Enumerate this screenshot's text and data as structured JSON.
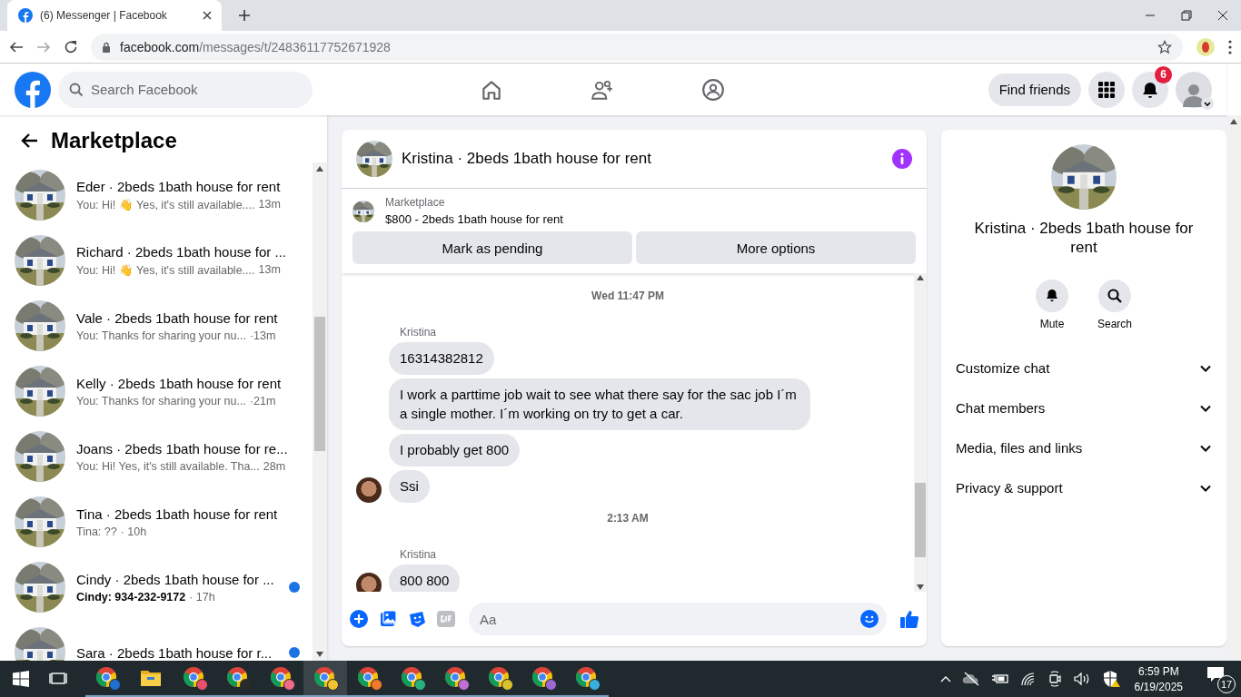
{
  "browser": {
    "tab": {
      "title": "(6) Messenger | Facebook"
    },
    "url": {
      "domain": "facebook.com",
      "path": "/messages/t/24836117752671928"
    }
  },
  "topbar": {
    "search": {
      "placeholder": "Search Facebook"
    },
    "nav": [
      {
        "kind": "home"
      },
      {
        "kind": "friends"
      },
      {
        "kind": "groups"
      }
    ],
    "find_friends": "Find friends",
    "notifications_badge": "6"
  },
  "sidebar": {
    "title": "Marketplace",
    "conversations": [
      {
        "title": "Eder · 2beds 1bath house for rent",
        "preview": "You: Hi! 👋 Yes, it's still available....",
        "time": "13m",
        "unread": false
      },
      {
        "title": "Richard · 2beds 1bath house for ...",
        "preview": "You: Hi! 👋 Yes, it's still available....",
        "time": "13m",
        "unread": false
      },
      {
        "title": "Vale · 2beds 1bath house for rent",
        "preview": "You: Thanks for sharing your nu...",
        "time": "·13m",
        "unread": false
      },
      {
        "title": "Kelly · 2beds 1bath house for rent",
        "preview": "You: Thanks for sharing your nu...",
        "time": "·21m",
        "unread": false
      },
      {
        "title": "Joans · 2beds 1bath house for re...",
        "preview": "You: Hi! Yes, it's still available. Tha...",
        "time": "28m",
        "unread": false
      },
      {
        "title": "Tina · 2beds 1bath house for rent",
        "preview": "Tina: ??",
        "time": "· 10h",
        "unread": false
      },
      {
        "title": "Cindy · 2beds 1bath house for ...",
        "preview": "Cindy: 934-232-9172",
        "time": "· 17h",
        "unread": true
      },
      {
        "title": "Sara · 2beds 1bath house for r...",
        "unread": true
      }
    ]
  },
  "chat": {
    "title": "Kristina · 2beds 1bath house for rent",
    "listing": {
      "source": "Marketplace",
      "name": "$800 - 2beds 1bath house for rent"
    },
    "actions": [
      "Mark as pending",
      "More options"
    ],
    "messages": [
      {
        "kind": "timestamp",
        "text": "Wed 11:47 PM"
      },
      {
        "kind": "sender",
        "text": "Kristina"
      },
      {
        "kind": "message",
        "text": "16314382812",
        "avatar": false
      },
      {
        "kind": "message",
        "text": "I work a parttime job  wait to see what there say for the sac job I´m a single mother. I´m working on try to get a car.",
        "avatar": false
      },
      {
        "kind": "message",
        "text": "I probably get 800",
        "avatar": false
      },
      {
        "kind": "message",
        "text": "Ssi",
        "avatar": true
      },
      {
        "kind": "timestamp",
        "text": "2:13 AM"
      },
      {
        "kind": "sender",
        "text": "Kristina"
      },
      {
        "kind": "message",
        "text": "800 800",
        "avatar": true
      }
    ],
    "composer": {
      "placeholder": "Aa"
    }
  },
  "details": {
    "title": "Kristina · 2beds 1bath house for rent",
    "actions": [
      {
        "kind": "mute",
        "label": "Mute"
      },
      {
        "kind": "search",
        "label": "Search"
      }
    ],
    "sections": [
      {
        "label": "Customize chat",
        "expanded": false
      },
      {
        "label": "Chat members",
        "expanded": false
      },
      {
        "label": "Media, files and links",
        "expanded": false
      },
      {
        "label": "Privacy & support",
        "expanded": false
      }
    ]
  },
  "taskbar": {
    "apps": [
      {
        "kind": "chrome",
        "color": "#1f6fd1",
        "selected": false
      },
      {
        "kind": "explorer",
        "selected": false
      },
      {
        "kind": "chrome",
        "color": "#e8506a",
        "selected": false
      },
      {
        "kind": "chrome",
        "color": "#2a2a2a",
        "selected": false
      },
      {
        "kind": "chrome",
        "color": "#f06a8a",
        "selected": false
      },
      {
        "kind": "chrome",
        "color": "#f2c230",
        "selected": true
      },
      {
        "kind": "chrome",
        "color": "#f07a2a",
        "selected": false
      },
      {
        "kind": "chrome",
        "color": "#2ab07a",
        "selected": false
      },
      {
        "kind": "chrome",
        "color": "#c070d0",
        "selected": false
      },
      {
        "kind": "chrome",
        "color": "#d8c030",
        "selected": false
      },
      {
        "kind": "chrome",
        "color": "#9a6ad0",
        "selected": false
      },
      {
        "kind": "chrome",
        "color": "#3ab0e0",
        "selected": false
      }
    ],
    "time": "6:59 PM",
    "date": "6/19/2025",
    "notifications": "17"
  }
}
